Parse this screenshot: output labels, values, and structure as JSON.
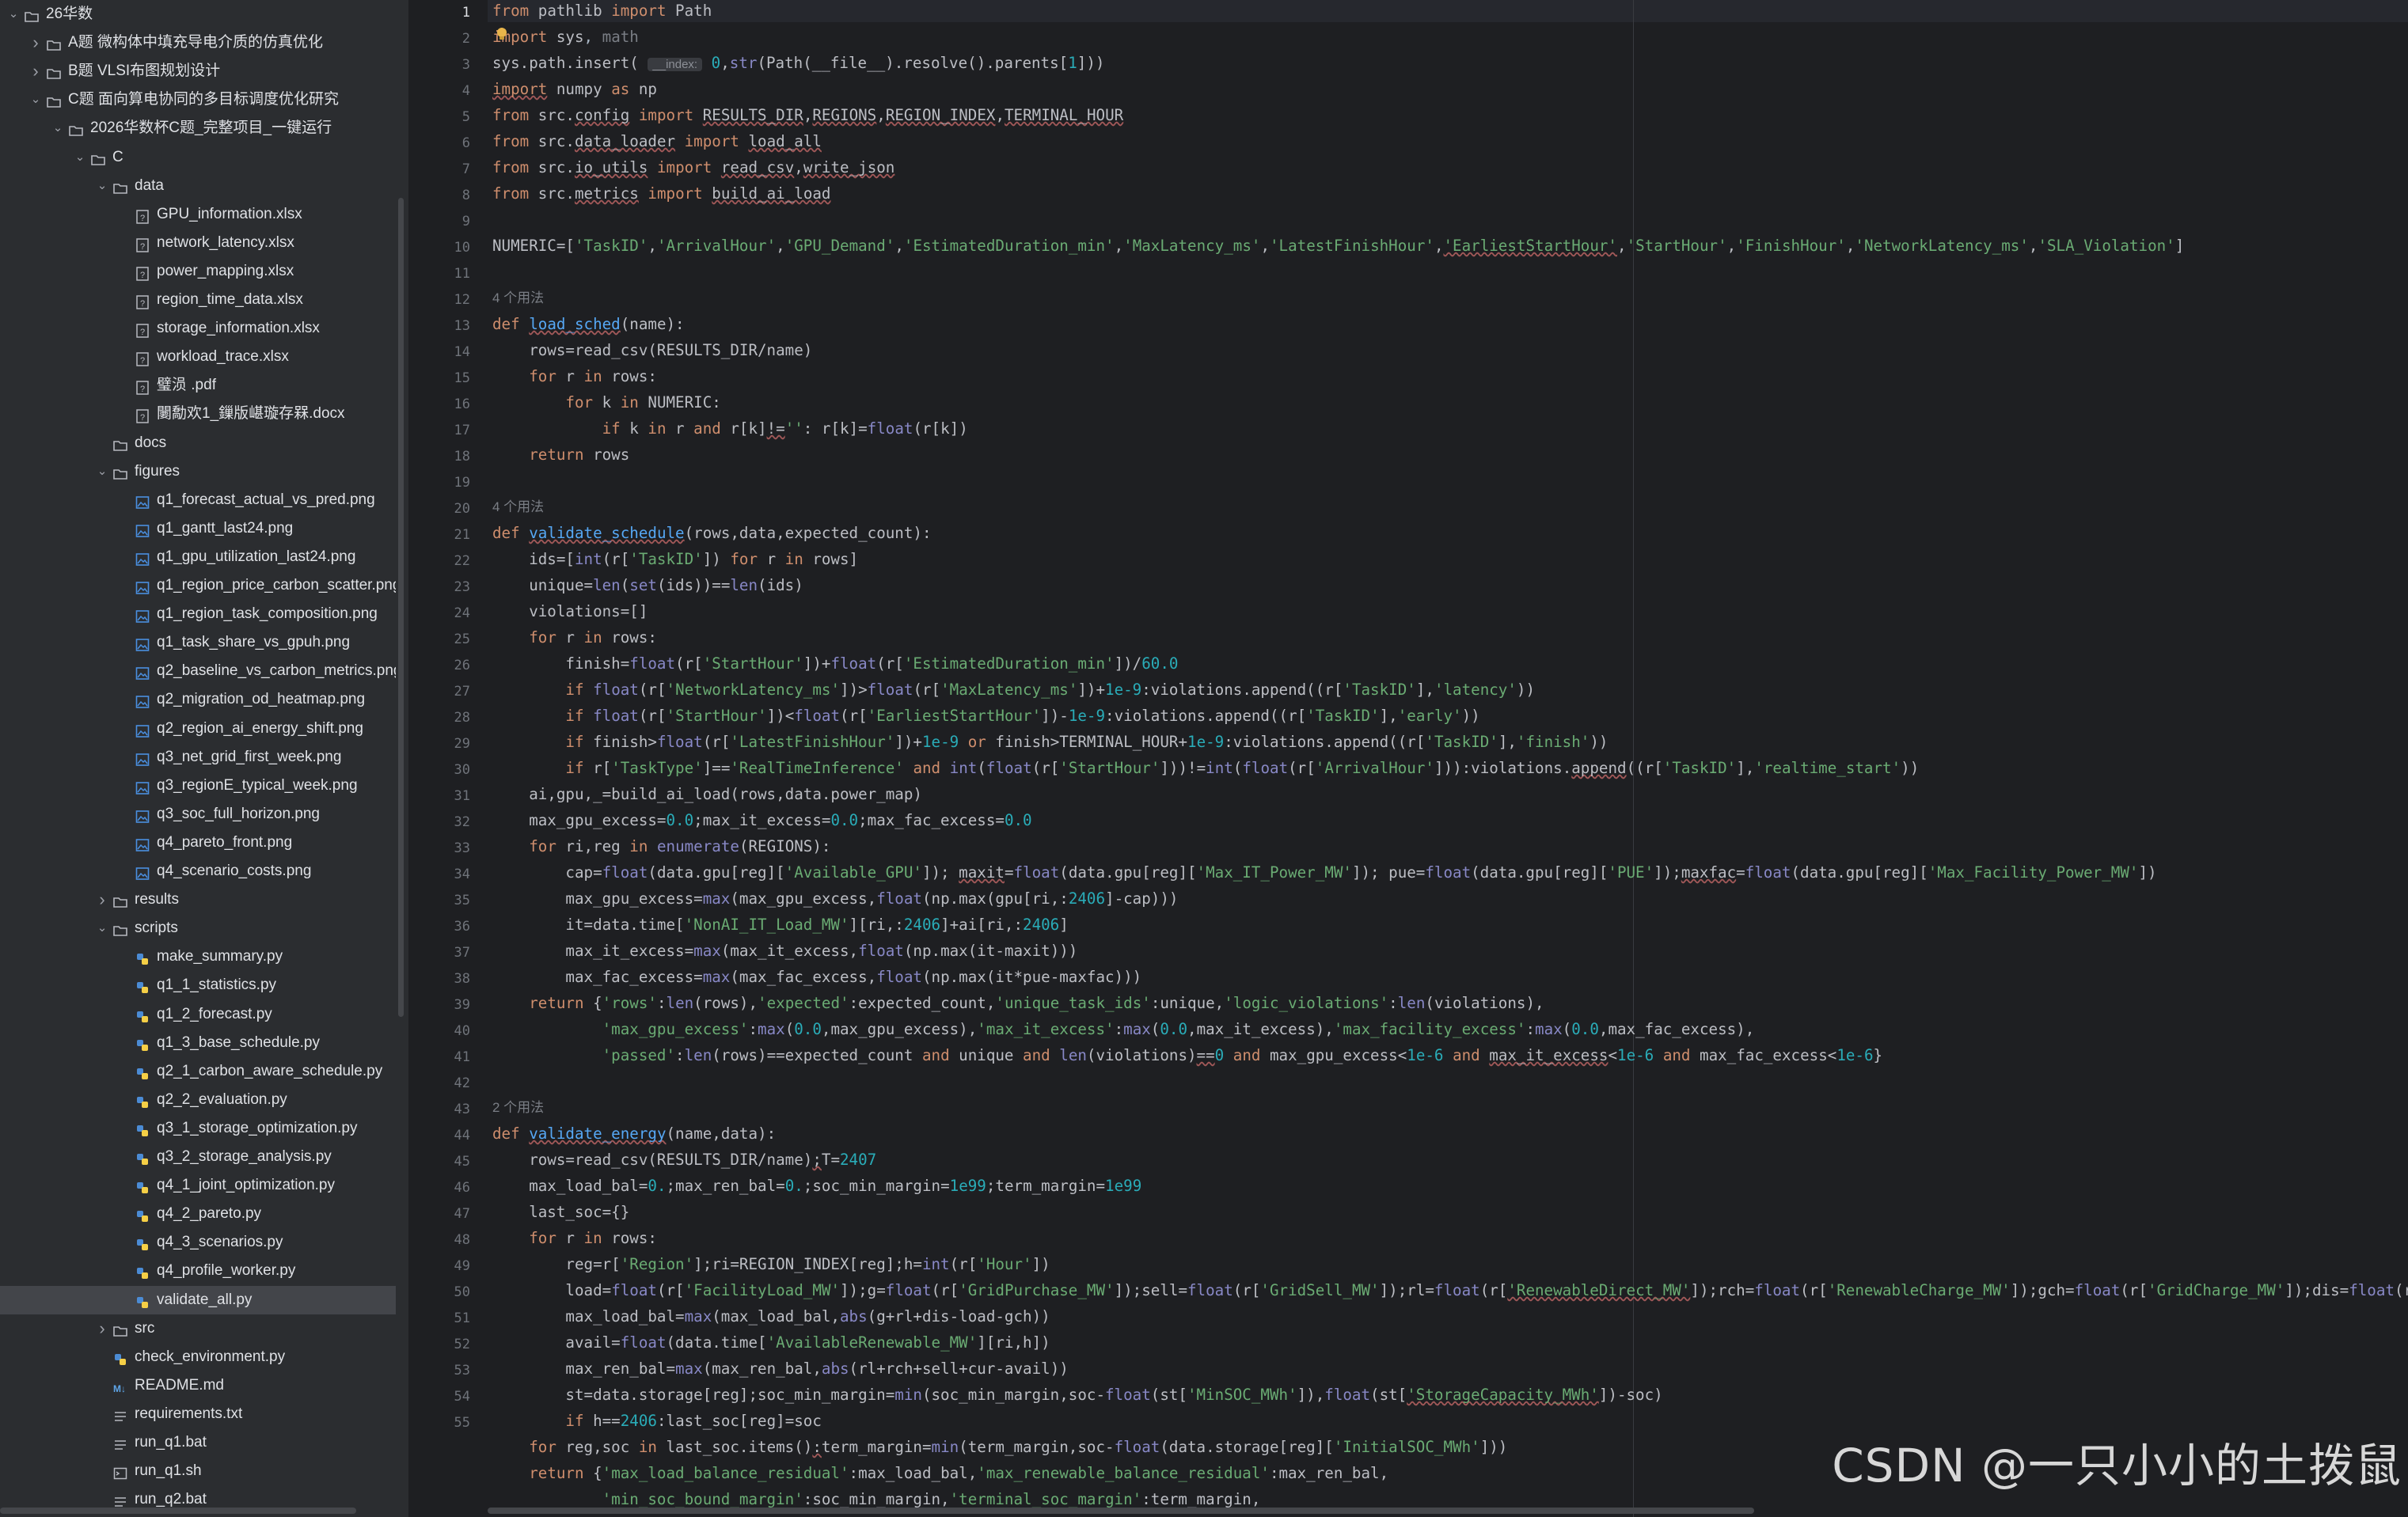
{
  "tree": {
    "items": [
      {
        "label": "26华数",
        "depth": 0,
        "type": "folder",
        "expanded": true
      },
      {
        "label": "A题 微构体中填充导电介质的仿真优化",
        "depth": 1,
        "type": "folder",
        "expanded": false
      },
      {
        "label": "B题 VLSI布图规划设计",
        "depth": 1,
        "type": "folder",
        "expanded": false
      },
      {
        "label": "C题 面向算电协同的多目标调度优化研究",
        "depth": 1,
        "type": "folder",
        "expanded": true
      },
      {
        "label": "2026华数杯C题_完整项目_一键运行",
        "depth": 2,
        "type": "folder",
        "expanded": true
      },
      {
        "label": "C",
        "depth": 3,
        "type": "folder",
        "expanded": true
      },
      {
        "label": "data",
        "depth": 4,
        "type": "folder",
        "expanded": true
      },
      {
        "label": "GPU_information.xlsx",
        "depth": 5,
        "type": "file"
      },
      {
        "label": "network_latency.xlsx",
        "depth": 5,
        "type": "file"
      },
      {
        "label": "power_mapping.xlsx",
        "depth": 5,
        "type": "file"
      },
      {
        "label": "region_time_data.xlsx",
        "depth": 5,
        "type": "file"
      },
      {
        "label": "storage_information.xlsx",
        "depth": 5,
        "type": "file"
      },
      {
        "label": "workload_trace.xlsx",
        "depth": 5,
        "type": "file"
      },
      {
        "label": "璧涢 .pdf",
        "depth": 5,
        "type": "file"
      },
      {
        "label": "闄勪欢1_鏁版嵁璇存槑.docx",
        "depth": 5,
        "type": "file"
      },
      {
        "label": "docs",
        "depth": 4,
        "type": "folder",
        "expanded": false,
        "nochev": true
      },
      {
        "label": "figures",
        "depth": 4,
        "type": "folder",
        "expanded": true
      },
      {
        "label": "q1_forecast_actual_vs_pred.png",
        "depth": 5,
        "type": "image"
      },
      {
        "label": "q1_gantt_last24.png",
        "depth": 5,
        "type": "image"
      },
      {
        "label": "q1_gpu_utilization_last24.png",
        "depth": 5,
        "type": "image"
      },
      {
        "label": "q1_region_price_carbon_scatter.png",
        "depth": 5,
        "type": "image"
      },
      {
        "label": "q1_region_task_composition.png",
        "depth": 5,
        "type": "image"
      },
      {
        "label": "q1_task_share_vs_gpuh.png",
        "depth": 5,
        "type": "image"
      },
      {
        "label": "q2_baseline_vs_carbon_metrics.png",
        "depth": 5,
        "type": "image"
      },
      {
        "label": "q2_migration_od_heatmap.png",
        "depth": 5,
        "type": "image"
      },
      {
        "label": "q2_region_ai_energy_shift.png",
        "depth": 5,
        "type": "image"
      },
      {
        "label": "q3_net_grid_first_week.png",
        "depth": 5,
        "type": "image"
      },
      {
        "label": "q3_regionE_typical_week.png",
        "depth": 5,
        "type": "image"
      },
      {
        "label": "q3_soc_full_horizon.png",
        "depth": 5,
        "type": "image"
      },
      {
        "label": "q4_pareto_front.png",
        "depth": 5,
        "type": "image"
      },
      {
        "label": "q4_scenario_costs.png",
        "depth": 5,
        "type": "image"
      },
      {
        "label": "results",
        "depth": 4,
        "type": "folder",
        "expanded": false
      },
      {
        "label": "scripts",
        "depth": 4,
        "type": "folder",
        "expanded": true
      },
      {
        "label": "make_summary.py",
        "depth": 5,
        "type": "python"
      },
      {
        "label": "q1_1_statistics.py",
        "depth": 5,
        "type": "python"
      },
      {
        "label": "q1_2_forecast.py",
        "depth": 5,
        "type": "python"
      },
      {
        "label": "q1_3_base_schedule.py",
        "depth": 5,
        "type": "python"
      },
      {
        "label": "q2_1_carbon_aware_schedule.py",
        "depth": 5,
        "type": "python"
      },
      {
        "label": "q2_2_evaluation.py",
        "depth": 5,
        "type": "python"
      },
      {
        "label": "q3_1_storage_optimization.py",
        "depth": 5,
        "type": "python"
      },
      {
        "label": "q3_2_storage_analysis.py",
        "depth": 5,
        "type": "python"
      },
      {
        "label": "q4_1_joint_optimization.py",
        "depth": 5,
        "type": "python"
      },
      {
        "label": "q4_2_pareto.py",
        "depth": 5,
        "type": "python"
      },
      {
        "label": "q4_3_scenarios.py",
        "depth": 5,
        "type": "python"
      },
      {
        "label": "q4_profile_worker.py",
        "depth": 5,
        "type": "python"
      },
      {
        "label": "validate_all.py",
        "depth": 5,
        "type": "python",
        "selected": true
      },
      {
        "label": "src",
        "depth": 4,
        "type": "folder",
        "expanded": false
      },
      {
        "label": "check_environment.py",
        "depth": 4,
        "type": "python"
      },
      {
        "label": "README.md",
        "depth": 4,
        "type": "markdown"
      },
      {
        "label": "requirements.txt",
        "depth": 4,
        "type": "text"
      },
      {
        "label": "run_q1.bat",
        "depth": 4,
        "type": "text"
      },
      {
        "label": "run_q1.sh",
        "depth": 4,
        "type": "shell"
      },
      {
        "label": "run_q2.bat",
        "depth": 4,
        "type": "text"
      }
    ]
  },
  "editor": {
    "hint_usages": {
      "four": "4 个用法",
      "two": "2 个用法"
    },
    "param_hint": "__index:",
    "watermark": "CSDN @一只小小的土拨鼠"
  },
  "colors": {
    "keyword": "#cf8e6d",
    "string": "#6aab73",
    "number": "#2aacb8",
    "function": "#56a8f5",
    "builtin": "#8888c6"
  }
}
